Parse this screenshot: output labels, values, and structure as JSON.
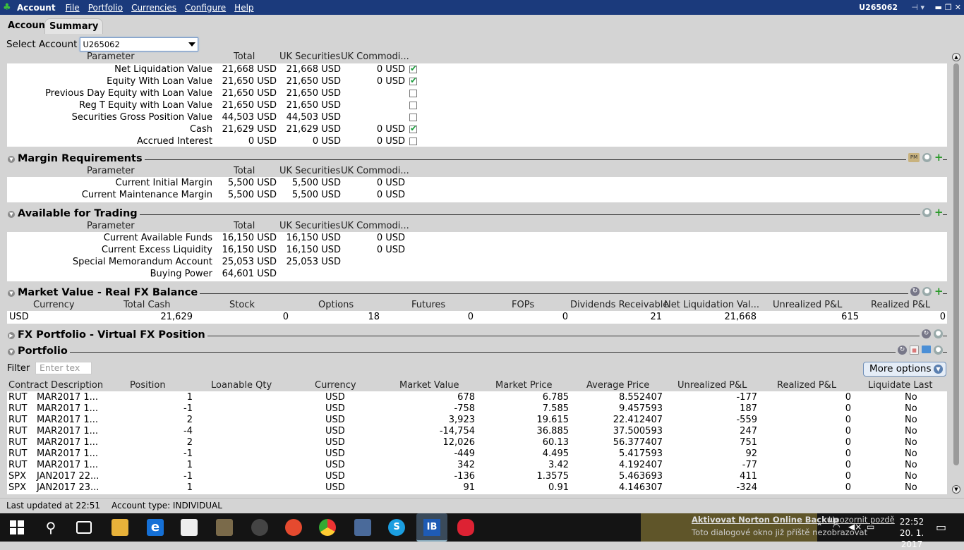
{
  "window": {
    "app_name": "Account",
    "menu": [
      "File",
      "Portfolio",
      "Currencies",
      "Configure",
      "Help"
    ],
    "account_id": "U265062"
  },
  "tabs": {
    "account": "Account",
    "summary": "Summary"
  },
  "select": {
    "label": "Select Account",
    "value": "U265062"
  },
  "balances": {
    "headers": [
      "Parameter",
      "Total",
      "UK Securities",
      "UK Commodi..."
    ],
    "rows": [
      {
        "param": "Net Liquidation Value",
        "total": "21,668 USD",
        "sec": "21,668 USD",
        "com": "0 USD",
        "checked": true
      },
      {
        "param": "Equity With Loan Value",
        "total": "21,650 USD",
        "sec": "21,650 USD",
        "com": "0 USD",
        "checked": true
      },
      {
        "param": "Previous Day Equity with Loan Value",
        "total": "21,650 USD",
        "sec": "21,650 USD",
        "com": "",
        "checked": false
      },
      {
        "param": "Reg T Equity with Loan Value",
        "total": "21,650 USD",
        "sec": "21,650 USD",
        "com": "",
        "checked": false
      },
      {
        "param": "Securities Gross Position Value",
        "total": "44,503 USD",
        "sec": "44,503 USD",
        "com": "",
        "checked": false
      },
      {
        "param": "Cash",
        "total": "21,629 USD",
        "sec": "21,629 USD",
        "com": "0 USD",
        "checked": true
      },
      {
        "param": "Accrued Interest",
        "total": "0 USD",
        "sec": "0 USD",
        "com": "0 USD",
        "checked": false
      }
    ]
  },
  "margin": {
    "title": "Margin Requirements",
    "headers": [
      "Parameter",
      "Total",
      "UK Securities",
      "UK Commodi..."
    ],
    "rows": [
      {
        "param": "Current Initial Margin",
        "total": "5,500 USD",
        "sec": "5,500 USD",
        "com": "0 USD"
      },
      {
        "param": "Current Maintenance Margin",
        "total": "5,500 USD",
        "sec": "5,500 USD",
        "com": "0 USD"
      }
    ]
  },
  "available": {
    "title": "Available for Trading",
    "headers": [
      "Parameter",
      "Total",
      "UK Securities",
      "UK Commodi..."
    ],
    "rows": [
      {
        "param": "Current Available Funds",
        "total": "16,150 USD",
        "sec": "16,150 USD",
        "com": "0 USD"
      },
      {
        "param": "Current Excess Liquidity",
        "total": "16,150 USD",
        "sec": "16,150 USD",
        "com": "0 USD"
      },
      {
        "param": "Special Memorandum Account",
        "total": "25,053 USD",
        "sec": "25,053 USD",
        "com": ""
      },
      {
        "param": "Buying Power",
        "total": "64,601 USD",
        "sec": "",
        "com": ""
      }
    ]
  },
  "market_value": {
    "title": "Market Value - Real FX Balance",
    "headers": [
      "Currency",
      "Total Cash",
      "Stock",
      "Options",
      "Futures",
      "FOPs",
      "Dividends Receivable",
      "Net Liquidation Val...",
      "Unrealized P&L",
      "Realized P&L"
    ],
    "row": [
      "USD",
      "21,629",
      "0",
      "18",
      "0",
      "0",
      "21",
      "21,668",
      "615",
      "0"
    ]
  },
  "fx_portfolio": {
    "title": "FX Portfolio - Virtual FX Position"
  },
  "portfolio": {
    "title": "Portfolio",
    "filter_label": "Filter",
    "filter_placeholder": "Enter tex",
    "more_options": "More options",
    "headers": [
      "Contract Description",
      "Position",
      "Loanable Qty",
      "Currency",
      "Market Value",
      "Market Price",
      "Average Price",
      "Unrealized P&L",
      "Realized P&L",
      "Liquidate Last"
    ],
    "rows": [
      [
        "RUT",
        "MAR2017 1...",
        "1",
        "",
        "USD",
        "678",
        "6.785",
        "8.552407",
        "-177",
        "0",
        "No"
      ],
      [
        "RUT",
        "MAR2017 1...",
        "-1",
        "",
        "USD",
        "-758",
        "7.585",
        "9.457593",
        "187",
        "0",
        "No"
      ],
      [
        "RUT",
        "MAR2017 1...",
        "2",
        "",
        "USD",
        "3,923",
        "19.615",
        "22.412407",
        "-559",
        "0",
        "No"
      ],
      [
        "RUT",
        "MAR2017 1...",
        "-4",
        "",
        "USD",
        "-14,754",
        "36.885",
        "37.500593",
        "247",
        "0",
        "No"
      ],
      [
        "RUT",
        "MAR2017 1...",
        "2",
        "",
        "USD",
        "12,026",
        "60.13",
        "56.377407",
        "751",
        "0",
        "No"
      ],
      [
        "RUT",
        "MAR2017 1...",
        "-1",
        "",
        "USD",
        "-449",
        "4.495",
        "5.417593",
        "92",
        "0",
        "No"
      ],
      [
        "RUT",
        "MAR2017 1...",
        "1",
        "",
        "USD",
        "342",
        "3.42",
        "4.192407",
        "-77",
        "0",
        "No"
      ],
      [
        "SPX",
        "JAN2017 22...",
        "-1",
        "",
        "USD",
        "-136",
        "1.3575",
        "5.463693",
        "411",
        "0",
        "No"
      ],
      [
        "SPX",
        "JAN2017 23...",
        "1",
        "",
        "USD",
        "91",
        "0.91",
        "4.146307",
        "-324",
        "0",
        "No"
      ]
    ]
  },
  "status": {
    "last_updated": "Last updated at 22:51",
    "account_type": "Account type: INDIVIDUAL"
  },
  "taskbar": {
    "notification_title": "Aktivovat Norton Online Backup",
    "notification_link": "Upozornit pozdě",
    "notification_text": "Toto dialogové okno již příště nezobrazovat",
    "time": "22:52",
    "date": "20. 1. 2017"
  },
  "colors": {
    "titlebar": "#1b3a7c",
    "check": "#1a9b3c",
    "panel": "#d4d4d4"
  }
}
